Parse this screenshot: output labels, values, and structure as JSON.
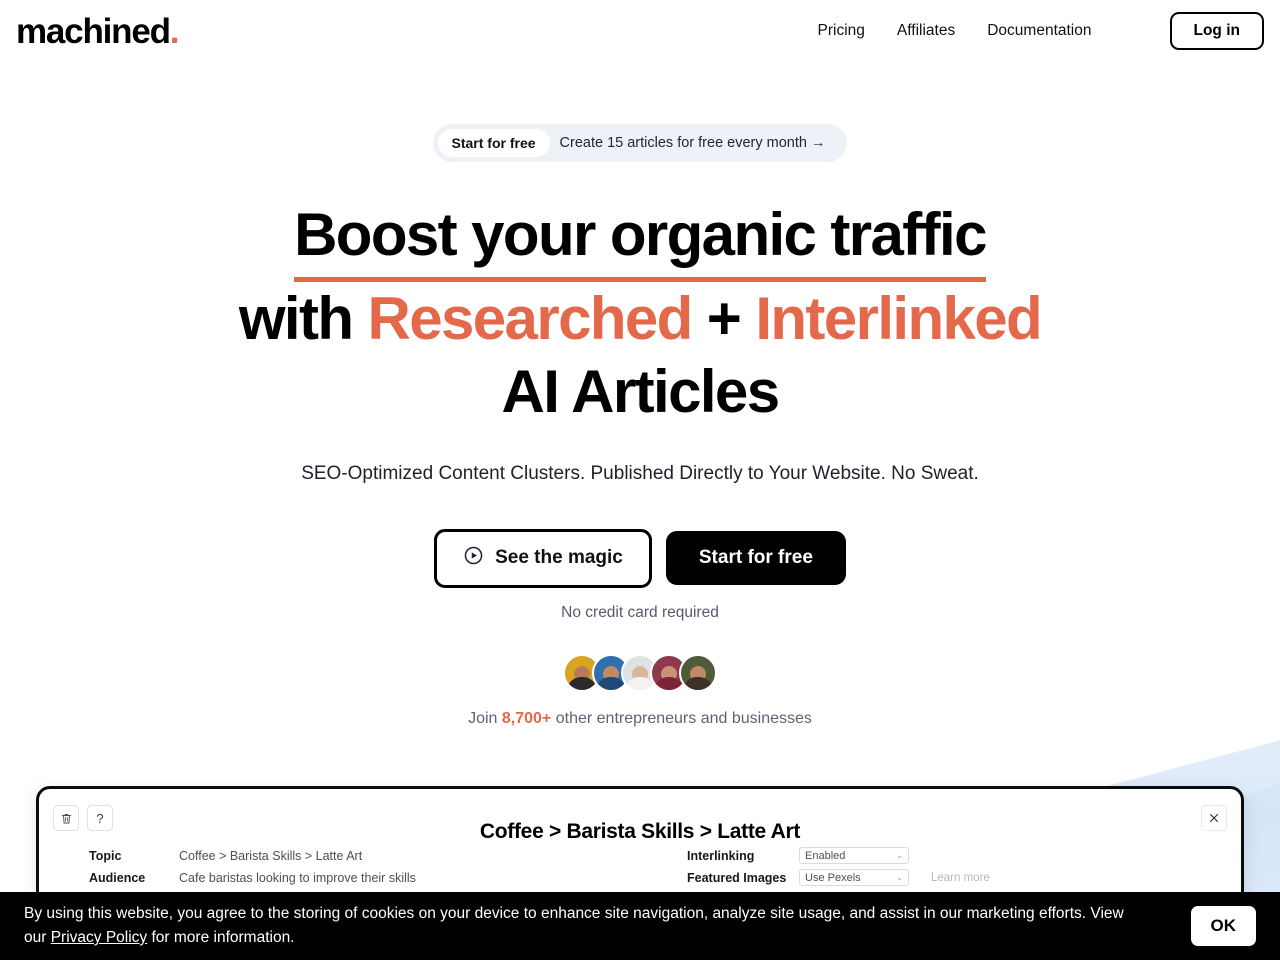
{
  "brand": {
    "name": "machined",
    "dot": ".",
    "accent": "#e4684a"
  },
  "nav": {
    "links": [
      {
        "label": "Pricing"
      },
      {
        "label": "Affiliates"
      },
      {
        "label": "Documentation"
      }
    ],
    "login_label": "Log in"
  },
  "hero": {
    "pill": {
      "badge": "Start for free",
      "text": "Create 15 articles for free every month",
      "arrow": "→"
    },
    "headline": {
      "line1": "Boost your organic traffic",
      "line2_prefix": "with ",
      "line2_accent1": "Researched",
      "line2_plus": " + ",
      "line2_accent2": "Interlinked",
      "line3": "AI Articles"
    },
    "subhead": "SEO-Optimized Content Clusters. Published Directly to Your Website. No Sweat.",
    "cta_secondary": "See the magic",
    "cta_primary": "Start for free",
    "no_card": "No credit card required",
    "avatars": [
      {
        "bg": "#d9a521",
        "skin": "#b9795a",
        "shirt": "#2a2a2a"
      },
      {
        "bg": "#2f6fae",
        "skin": "#c08a64",
        "shirt": "#1d4a79"
      },
      {
        "bg": "#dfe2e5",
        "skin": "#d9b79b",
        "shirt": "#f2f2f2"
      },
      {
        "bg": "#8d3a4c",
        "skin": "#c99272",
        "shirt": "#7c2438"
      },
      {
        "bg": "#4e5a3a",
        "skin": "#c08a64",
        "shirt": "#3d3228"
      }
    ],
    "join_prefix": "Join ",
    "join_count": "8,700+",
    "join_suffix": " other entrepreneurs and businesses"
  },
  "panel": {
    "title": "Coffee > Barista Skills > Latte Art",
    "trash_icon": "🗑",
    "help_icon": "?",
    "close_icon": "✕",
    "left_fields": [
      {
        "label": "Topic",
        "value": "Coffee > Barista Skills > Latte Art"
      },
      {
        "label": "Audience",
        "value": "Cafe baristas looking to improve their skills"
      }
    ],
    "right_fields": [
      {
        "label": "Interlinking",
        "value": "Enabled",
        "extra": ""
      },
      {
        "label": "Featured Images",
        "value": "Use Pexels",
        "extra": "Learn more"
      }
    ],
    "chevron": "⌄"
  },
  "cookie": {
    "text_before": "By using this website, you agree to the storing of cookies on your device to enhance site navigation, analyze site usage, and assist in our marketing efforts. View our ",
    "link": "Privacy Policy",
    "text_after": " for more information.",
    "ok_label": "OK"
  }
}
